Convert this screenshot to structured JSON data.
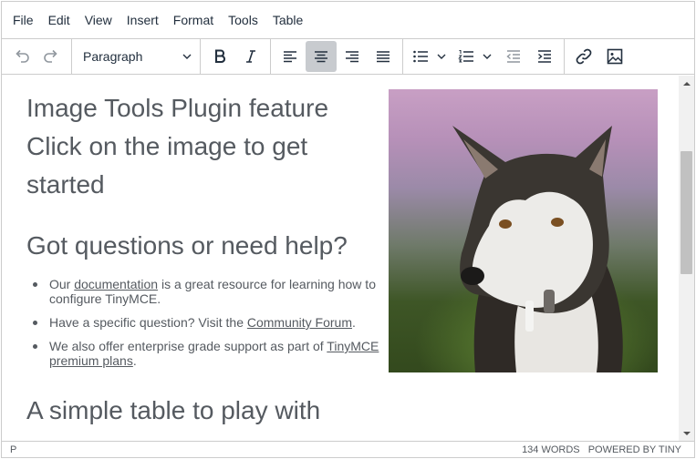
{
  "menubar": {
    "items": [
      "File",
      "Edit",
      "View",
      "Insert",
      "Format",
      "Tools",
      "Table"
    ]
  },
  "toolbar": {
    "block_format": "Paragraph",
    "buttons": {
      "undo": "undo-icon",
      "redo": "redo-icon",
      "bold": "bold-icon",
      "italic": "italic-icon",
      "align_left": "align-left-icon",
      "align_center": "align-center-icon",
      "align_right": "align-right-icon",
      "justify": "align-justify-icon",
      "bullet_list": "bullet-list-icon",
      "numbered_list": "numbered-list-icon",
      "outdent": "outdent-icon",
      "indent": "indent-icon",
      "link": "link-icon",
      "image": "image-icon"
    },
    "active_button": "align_center"
  },
  "content": {
    "heading1": "Image Tools Plugin feature Click on the image to get started",
    "heading2": "Got questions or need help?",
    "list": [
      {
        "before": "Our ",
        "link": "documentation",
        "after": " is a great resource for learning how to configure TinyMCE."
      },
      {
        "before": "Have a specific question? Visit the ",
        "link": "Community Forum",
        "after": "."
      },
      {
        "before": "We also offer enterprise grade support as part of ",
        "link": "TinyMCE premium plans",
        "after": "."
      }
    ],
    "heading3": "A simple table to play with",
    "image_subject": "husky-dog"
  },
  "statusbar": {
    "path": "P",
    "word_count": "134 WORDS",
    "powered_by": "POWERED BY TINY"
  },
  "colors": {
    "text": "#222f3e",
    "content_text": "#555a60",
    "border": "#cccccc",
    "active_button": "#c8cbcf"
  }
}
